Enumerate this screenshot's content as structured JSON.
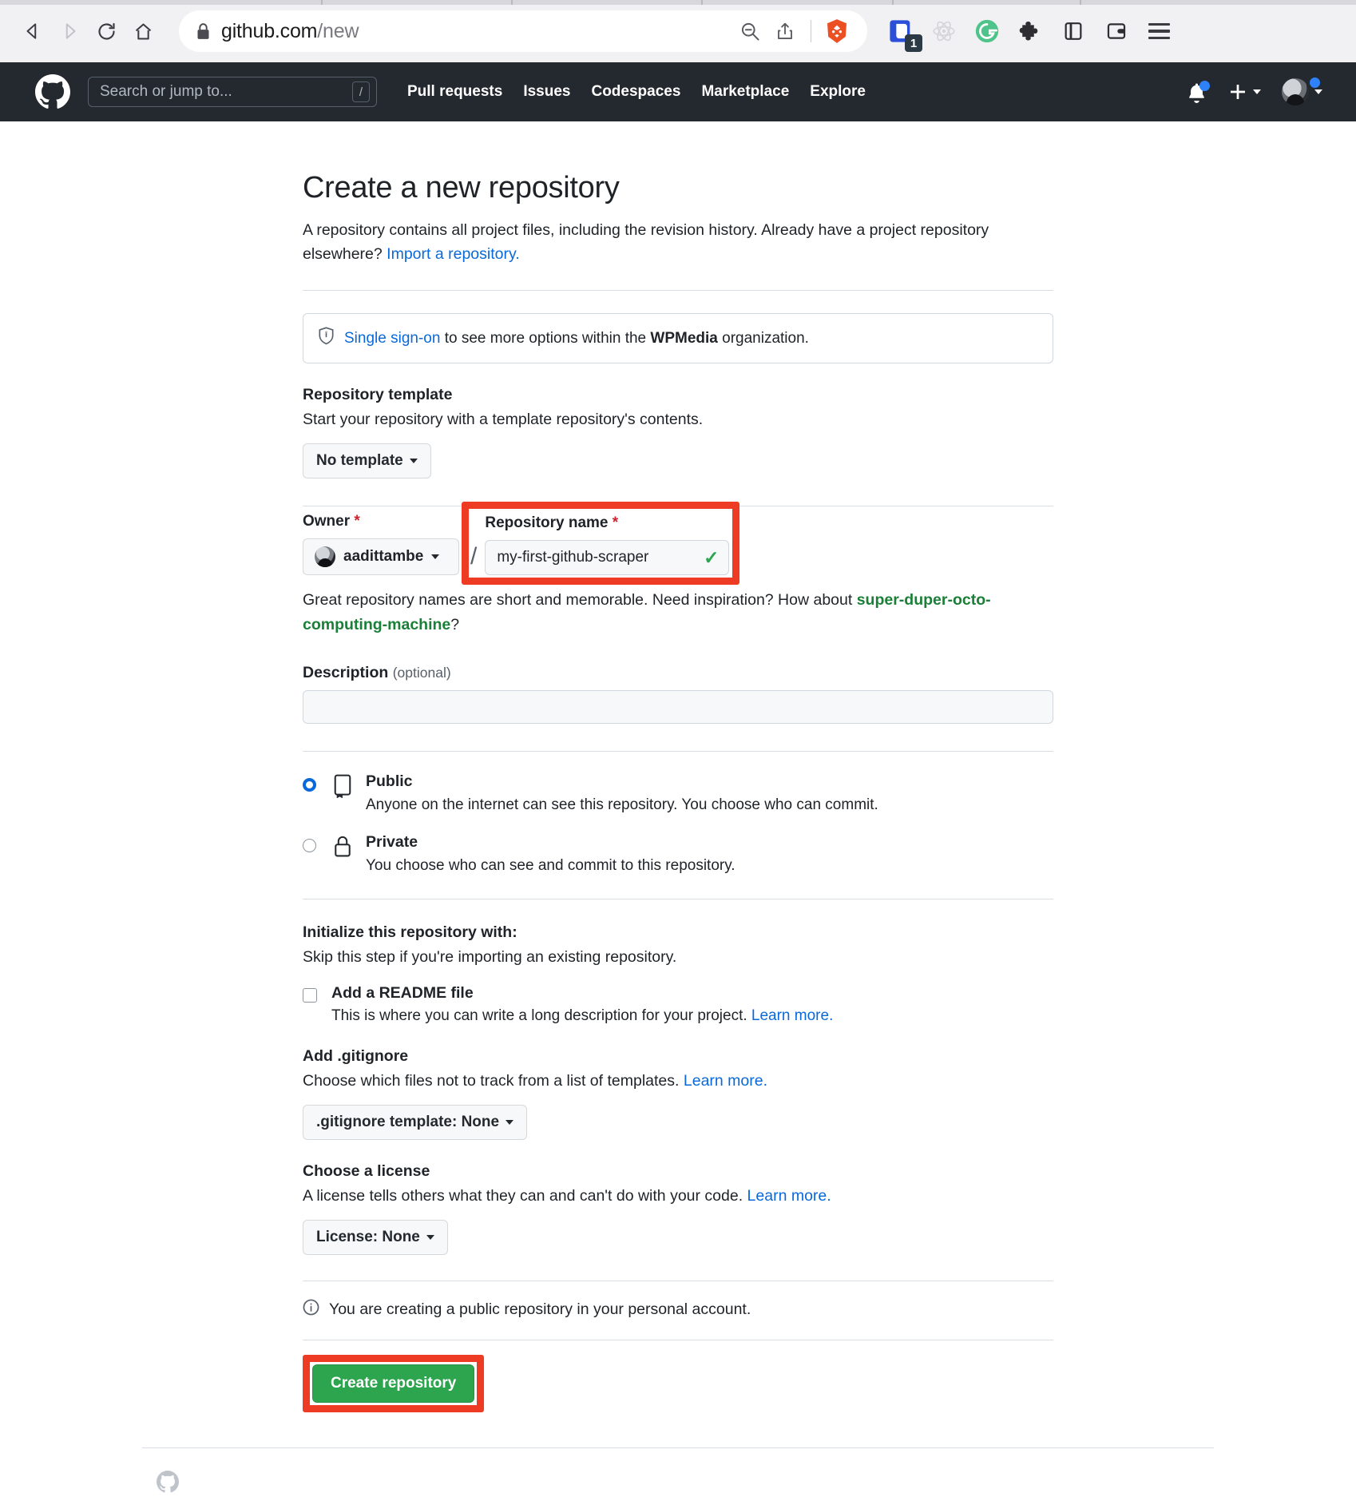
{
  "browser": {
    "url_bold": "github.com",
    "url_dim": "/new",
    "back_icon": "back-arrow-icon",
    "forward_icon": "forward-arrow-icon",
    "reload_icon": "reload-icon",
    "home_icon": "home-icon",
    "lock_icon": "lock-icon",
    "zoom_out_icon": "zoom-out-icon",
    "share_icon": "share-icon",
    "brave_icon": "brave-lion-icon",
    "extension_badge": "1",
    "menu_icon": "hamburger-menu-icon"
  },
  "gh_header": {
    "logo": "github-mark-icon",
    "search_placeholder": "Search or jump to...",
    "search_shortcut": "/",
    "nav": [
      {
        "label": "Pull requests"
      },
      {
        "label": "Issues"
      },
      {
        "label": "Codespaces"
      },
      {
        "label": "Marketplace"
      },
      {
        "label": "Explore"
      }
    ],
    "notifications_icon": "bell-icon",
    "create_new_icon": "plus-icon",
    "avatar_icon": "user-avatar"
  },
  "page": {
    "title": "Create a new repository",
    "subtitle_part1": "A repository contains all project files, including the revision history. Already have a project repository elsewhere? ",
    "subtitle_link": "Import a repository.",
    "sso": {
      "icon": "shield-lock-icon",
      "link": "Single sign-on",
      "text_mid": " to see more options within the ",
      "org": "WPMedia",
      "text_end": " organization."
    },
    "template": {
      "label": "Repository template",
      "desc": "Start your repository with a template repository's contents.",
      "button": "No template"
    },
    "owner": {
      "label": "Owner",
      "required_mark": "*",
      "value": "aadittambe"
    },
    "separator": "/",
    "repo_name": {
      "label": "Repository name",
      "required_mark": "*",
      "value": "my-first-github-scraper",
      "valid_check": "✓"
    },
    "name_hint": {
      "pre": "Great repository names are short and memorable. Need inspiration? How about ",
      "suggestion": "super-duper-octo-computing-machine",
      "post": "?"
    },
    "description": {
      "label": "Description",
      "optional": "(optional)",
      "value": "",
      "placeholder": ""
    },
    "visibility": [
      {
        "name": "Public",
        "desc": "Anyone on the internet can see this repository. You choose who can commit.",
        "icon": "repo-book-icon",
        "selected": true
      },
      {
        "name": "Private",
        "desc": "You choose who can see and commit to this repository.",
        "icon": "lock-icon",
        "selected": false
      }
    ],
    "initialize": {
      "label": "Initialize this repository with:",
      "desc": "Skip this step if you're importing an existing repository.",
      "readme": {
        "label": "Add a README file",
        "desc_pre": "This is where you can write a long description for your project. ",
        "desc_link": "Learn more.",
        "checked": false
      },
      "gitignore": {
        "label": "Add .gitignore",
        "desc_pre": "Choose which files not to track from a list of templates. ",
        "desc_link": "Learn more.",
        "button": ".gitignore template: None"
      },
      "license": {
        "label": "Choose a license",
        "desc_pre": "A license tells others what they can and can't do with your code. ",
        "desc_link": "Learn more.",
        "button": "License: None"
      }
    },
    "info_note": {
      "icon": "info-icon",
      "text": "You are creating a public repository in your personal account."
    },
    "create_button": "Create repository"
  },
  "annotations": {
    "color": "#ee3b23",
    "boxes": [
      {
        "name": "repository-name-highlight"
      },
      {
        "name": "create-repository-highlight"
      }
    ]
  }
}
